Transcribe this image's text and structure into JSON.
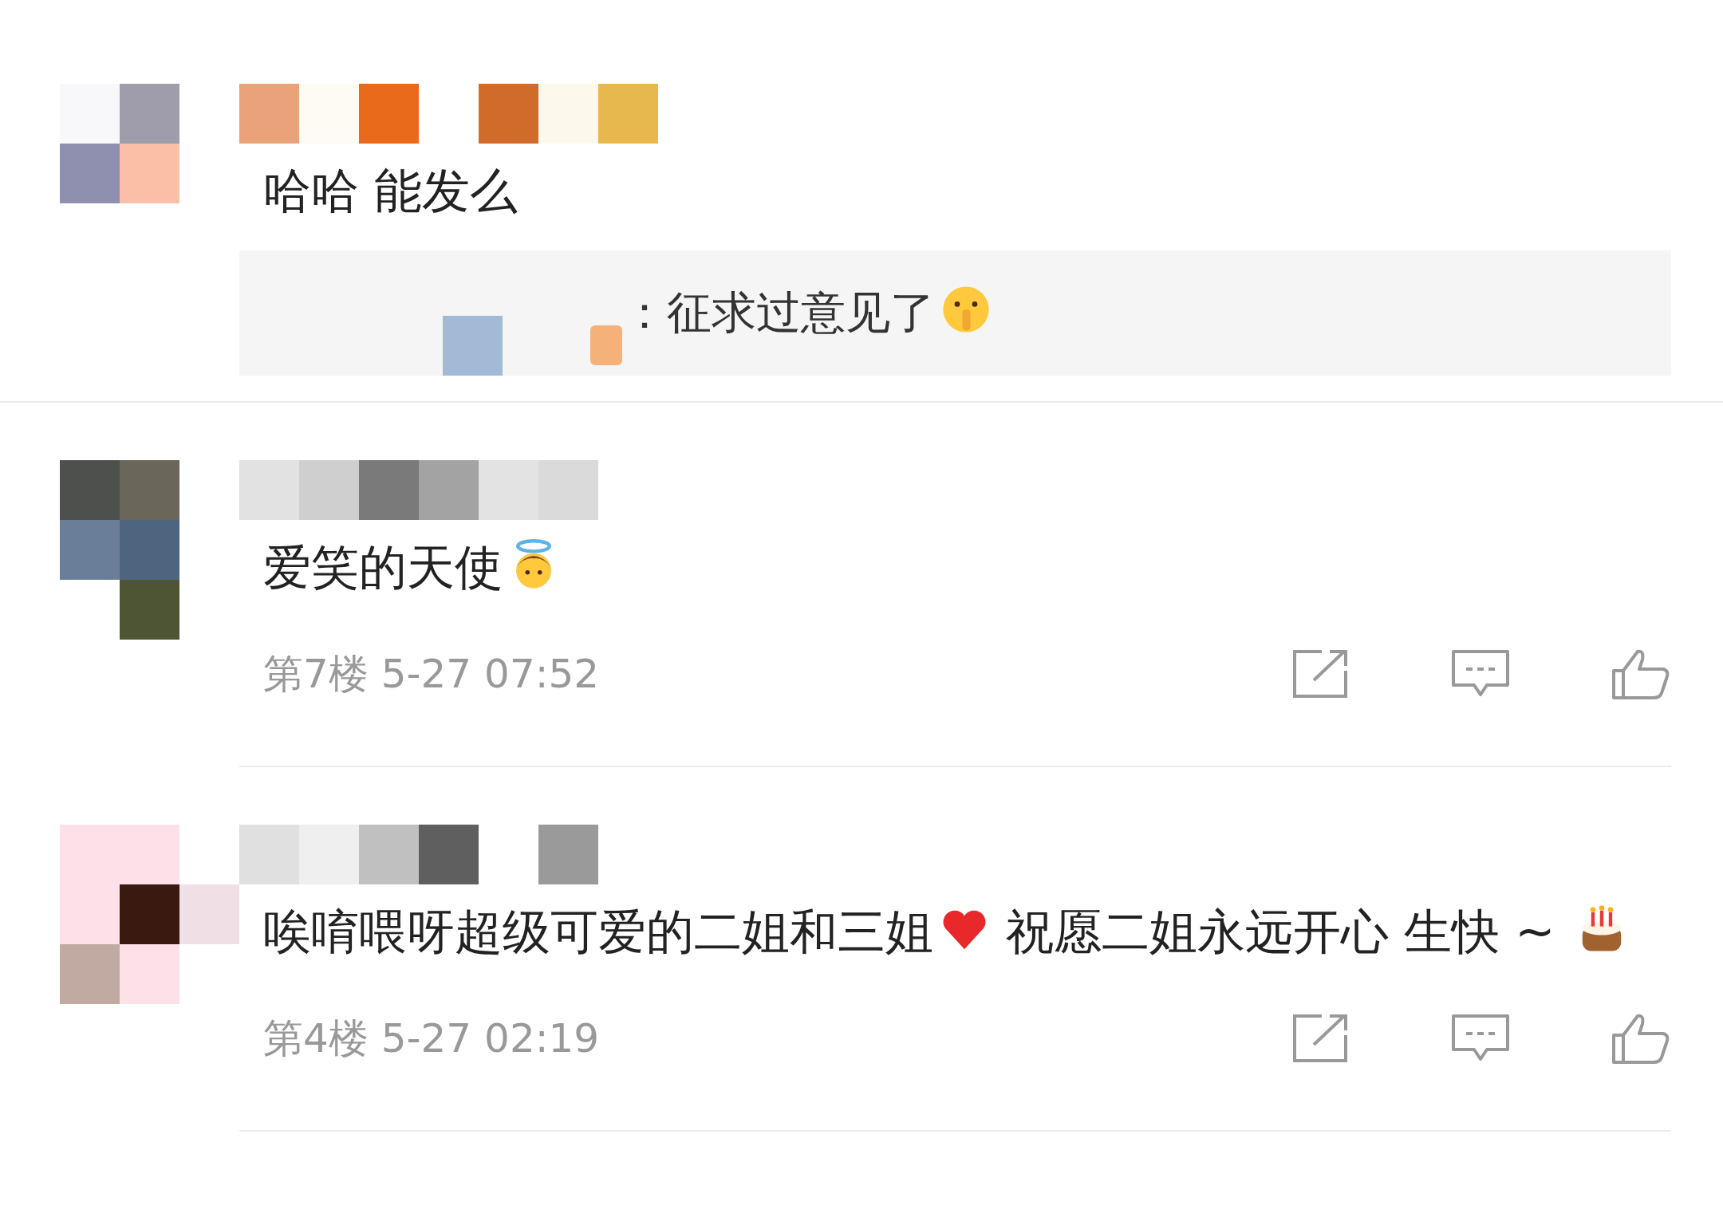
{
  "comments": [
    {
      "body": [
        {
          "kind": "text",
          "text": "哈哈 能发么"
        }
      ],
      "reply": {
        "body": [
          {
            "kind": "text",
            "text": "：征求过意见了"
          },
          {
            "kind": "shush"
          }
        ]
      }
    },
    {
      "body": [
        {
          "kind": "text",
          "text": "爱笑的天使"
        },
        {
          "kind": "angel"
        }
      ],
      "meta": "第7楼 5-27 07:52"
    },
    {
      "body": [
        {
          "kind": "text",
          "text": "唉唷喂呀超级可爱的二姐和三姐"
        },
        {
          "kind": "heart"
        },
        {
          "kind": "text",
          "text": " 祝愿二姐永远开心 生快 ~ "
        },
        {
          "kind": "cake"
        }
      ],
      "meta": "第4楼 5-27 02:19"
    }
  ]
}
